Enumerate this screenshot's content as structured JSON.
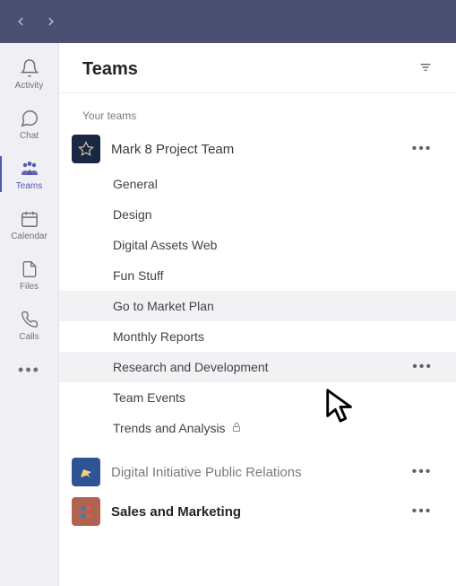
{
  "rail": {
    "items": [
      {
        "icon": "bell",
        "label": "Activity"
      },
      {
        "icon": "chat",
        "label": "Chat"
      },
      {
        "icon": "people",
        "label": "Teams"
      },
      {
        "icon": "calendar",
        "label": "Calendar"
      },
      {
        "icon": "file",
        "label": "Files"
      },
      {
        "icon": "phone",
        "label": "Calls"
      }
    ]
  },
  "header": {
    "title": "Teams"
  },
  "section_label": "Your teams",
  "teams": [
    {
      "name": "Mark 8 Project Team",
      "avatar_bg": "#1a2744",
      "channels": [
        {
          "name": "General"
        },
        {
          "name": "Design"
        },
        {
          "name": "Digital Assets Web"
        },
        {
          "name": "Fun Stuff"
        },
        {
          "name": "Go to Market Plan",
          "highlight": true
        },
        {
          "name": "Monthly Reports"
        },
        {
          "name": "Research and Development",
          "highlight": true,
          "show_more": true
        },
        {
          "name": "Team Events"
        },
        {
          "name": "Trends and Analysis",
          "private": true
        }
      ]
    },
    {
      "name": "Digital Initiative Public Relations",
      "avatar_bg": "#2f5496",
      "muted": true
    },
    {
      "name": "Sales and Marketing",
      "avatar_bg": "#b0634f",
      "bold": true
    }
  ]
}
